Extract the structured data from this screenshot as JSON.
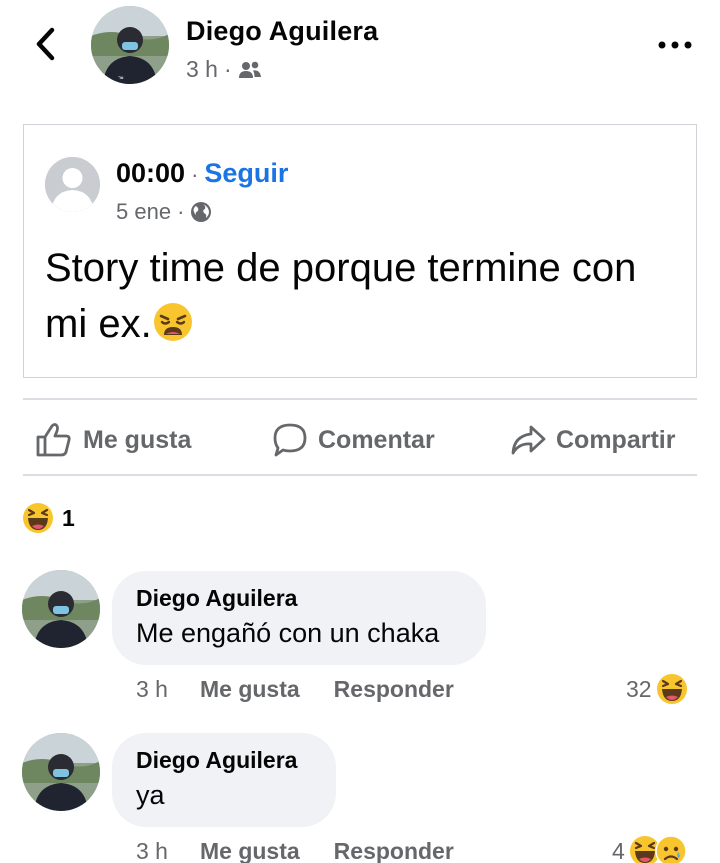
{
  "header": {
    "name": "Diego Aguilera",
    "time": "3 h",
    "separator": "·",
    "audience_icon": "friends-icon"
  },
  "shared_post": {
    "author": "00:00",
    "separator": "·",
    "follow_label": "Seguir",
    "date": "5 ene",
    "audience_icon": "globe-icon",
    "text": "Story time de porque termine con mi ex."
  },
  "actions": {
    "like_label": "Me gusta",
    "comment_label": "Comentar",
    "share_label": "Compartir"
  },
  "reactions_summary": {
    "count": "1",
    "icon": "haha-emoji-icon"
  },
  "comments": [
    {
      "author": "Diego Aguilera",
      "text": "Me engañó con un chaka",
      "time": "3 h",
      "like_label": "Me gusta",
      "reply_label": "Responder",
      "reaction_count": "32"
    },
    {
      "author": "Diego Aguilera",
      "text": "ya",
      "time": "3 h",
      "like_label": "Me gusta",
      "reply_label": "Responder",
      "reaction_count": "4"
    }
  ],
  "colors": {
    "accent": "#1b74e4",
    "secondary_text": "#65676b",
    "bubble": "#f0f2f5"
  }
}
